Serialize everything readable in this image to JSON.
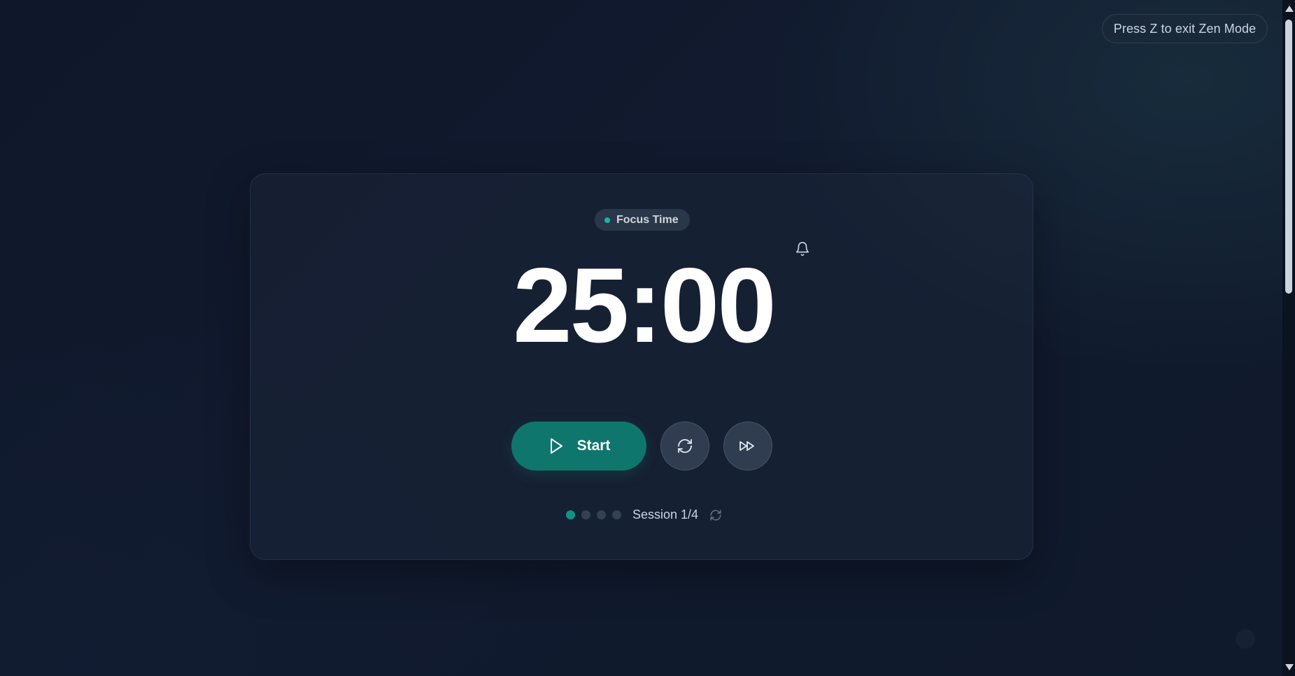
{
  "zen_hint": "Press Z to exit Zen Mode",
  "timer": {
    "mode_label": "Focus Time",
    "time": "25:00"
  },
  "controls": {
    "start_label": "Start"
  },
  "session": {
    "label": "Session 1/4",
    "current": 1,
    "total": 4
  },
  "icons": {
    "bell": "bell-icon",
    "play": "play-icon",
    "reset": "refresh-icon",
    "skip": "fast-forward-icon",
    "session_reset": "refresh-icon"
  },
  "colors": {
    "accent": "#0f766e",
    "accent_dot": "#14b8a6",
    "background": "#0f172a"
  }
}
